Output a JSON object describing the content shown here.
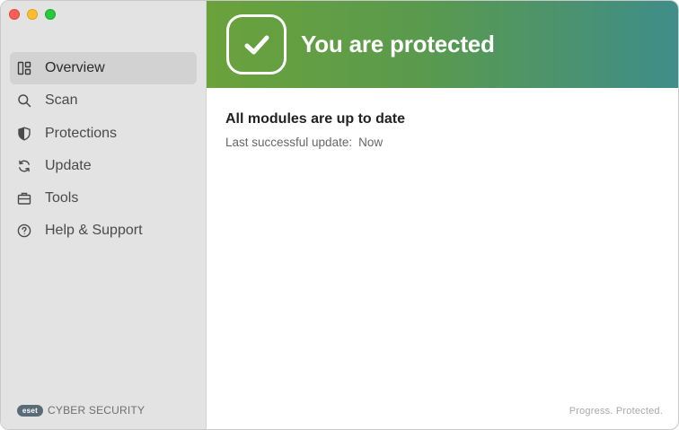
{
  "sidebar": {
    "items": [
      {
        "label": "Overview",
        "icon": "overview-icon",
        "active": true
      },
      {
        "label": "Scan",
        "icon": "search-icon"
      },
      {
        "label": "Protections",
        "icon": "shield-icon"
      },
      {
        "label": "Update",
        "icon": "refresh-icon"
      },
      {
        "label": "Tools",
        "icon": "toolbox-icon"
      },
      {
        "label": "Help & Support",
        "icon": "help-icon"
      }
    ],
    "brand": {
      "logo_text": "eset",
      "product": "CYBER SECURITY"
    }
  },
  "banner": {
    "title": "You are protected",
    "icon": "checkmark-icon",
    "colors": {
      "start": "#6aa23b",
      "end": "#3f8d8a"
    }
  },
  "main": {
    "status_title": "All modules are up to date",
    "last_update_label": "Last successful update:",
    "last_update_value": "Now",
    "tagline": "Progress. Protected."
  }
}
